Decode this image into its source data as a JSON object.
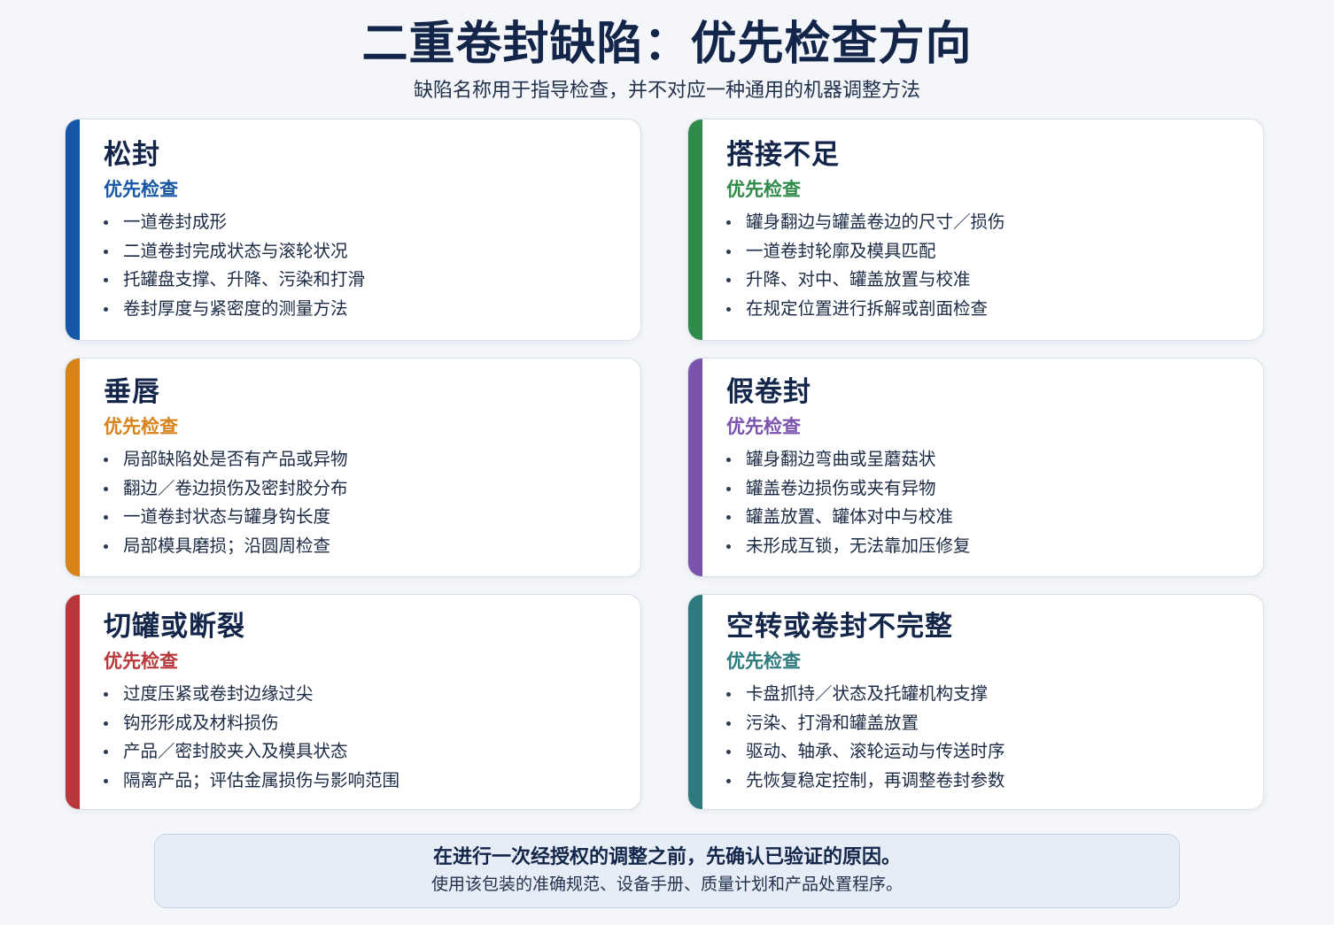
{
  "header": {
    "title": "二重卷封缺陷：优先检查方向",
    "subtitle": "缺陷名称用于指导检查，并不对应一种通用的机器调整方法"
  },
  "cards": [
    {
      "title": "松封",
      "subtitle": "优先检查",
      "color": "#1557a6",
      "items": [
        "一道卷封成形",
        "二道卷封完成状态与滚轮状况",
        "托罐盘支撑、升降、污染和打滑",
        "卷封厚度与紧密度的测量方法"
      ]
    },
    {
      "title": "搭接不足",
      "subtitle": "优先检查",
      "color": "#2e8b4a",
      "items": [
        "罐身翻边与罐盖卷边的尺寸／损伤",
        "一道卷封轮廓及模具匹配",
        "升降、对中、罐盖放置与校准",
        "在规定位置进行拆解或剖面检查"
      ]
    },
    {
      "title": "垂唇",
      "subtitle": "优先检查",
      "color": "#d8821a",
      "items": [
        "局部缺陷处是否有产品或异物",
        "翻边／卷边损伤及密封胶分布",
        "一道卷封状态与罐身钩长度",
        "局部模具磨损；沿圆周检查"
      ]
    },
    {
      "title": "假卷封",
      "subtitle": "优先检查",
      "color": "#7b52ad",
      "items": [
        "罐身翻边弯曲或呈蘑菇状",
        "罐盖卷边损伤或夹有异物",
        "罐盖放置、罐体对中与校准",
        "未形成互锁，无法靠加压修复"
      ]
    },
    {
      "title": "切罐或断裂",
      "subtitle": "优先检查",
      "color": "#b8373a",
      "items": [
        "过度压紧或卷封边缘过尖",
        "钩形形成及材料损伤",
        "产品／密封胶夹入及模具状态",
        "隔离产品；评估金属损伤与影响范围"
      ]
    },
    {
      "title": "空转或卷封不完整",
      "subtitle": "优先检查",
      "color": "#2d7a7f",
      "items": [
        "卡盘抓持／状态及托罐机构支撑",
        "污染、打滑和罐盖放置",
        "驱动、轴承、滚轮运动与传送时序",
        "先恢复稳定控制，再调整卷封参数"
      ]
    }
  ],
  "footer": {
    "main": "在进行一次经授权的调整之前，先确认已验证的原因。",
    "sub": "使用该包装的准确规范、设备手册、质量计划和产品处置程序。"
  }
}
